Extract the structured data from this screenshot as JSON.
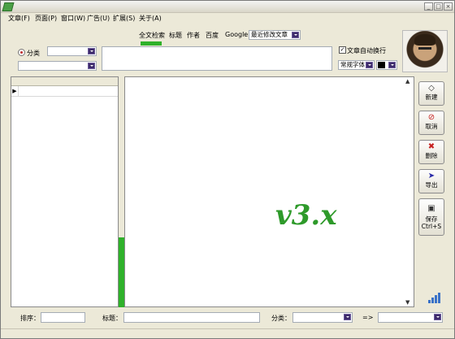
{
  "window": {
    "minimize_glyph": "_",
    "restore_glyph": "□",
    "close_glyph": "×"
  },
  "menu": [
    {
      "label": "文章(F)"
    },
    {
      "label": "页面(P)"
    },
    {
      "label": "窗口(W)"
    },
    {
      "label": "广告(U)"
    },
    {
      "label": "扩展(S)"
    },
    {
      "label": "关于(A)"
    }
  ],
  "search_tabs": [
    {
      "label": "全文检索",
      "active": true
    },
    {
      "label": "标题"
    },
    {
      "label": "作者"
    },
    {
      "label": "百度"
    },
    {
      "label": "Google"
    }
  ],
  "recent_select": {
    "value": "最近修改文章"
  },
  "category_radio": {
    "label": "分类"
  },
  "auto_wrap": {
    "label": "文章自动换行",
    "checked": true
  },
  "font_select": {
    "value": "常规字体"
  },
  "color_select": {
    "value": "#000000"
  },
  "editor": {
    "version_text": "v3.x",
    "scroll_up": "▲",
    "scroll_down": "▼"
  },
  "side_buttons": [
    {
      "label": "新建",
      "icon": "new-icon"
    },
    {
      "label": "取消",
      "icon": "cancel-icon"
    },
    {
      "label": "删除",
      "icon": "delete-icon"
    },
    {
      "label": "导出",
      "icon": "export-icon"
    },
    {
      "label": "保存\nCtrl+S",
      "icon": "save-icon"
    }
  ],
  "bottom": {
    "sort_label": "排序：",
    "title_label": "标题：",
    "category_label": "分类：",
    "arrow_label": "=>"
  },
  "colors": {
    "accent_green": "#2fb12a",
    "version_green": "#2e9a2a"
  }
}
